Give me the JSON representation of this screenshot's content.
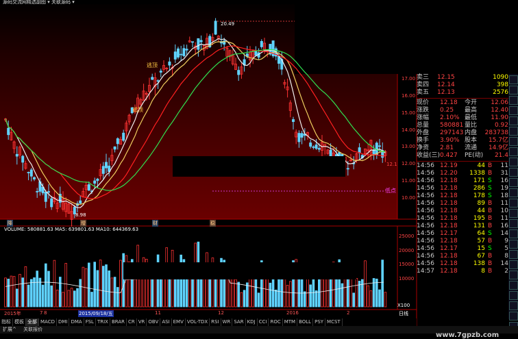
{
  "title_bar": {
    "text": "源码交流网精选副图 ▾ 关联源码 ▾"
  },
  "chart": {
    "price_labels": [
      "17.00",
      "16.00",
      "15.00",
      "14.00",
      "13.00",
      "12.00",
      "11.00",
      "10.00"
    ],
    "volume_labels": [
      "25000",
      "20000",
      "15000",
      "10000"
    ],
    "volume_multiplier": "X100",
    "high_label": "20.49",
    "low_label": "8.98",
    "current_price_tag": "12.1",
    "annotations": [
      "逃顶",
      "逃顶",
      "低点"
    ],
    "indicator_row": [
      "降",
      "增",
      "财",
      "稳"
    ],
    "volume_title": "VOLUME: 580881.63  MA5: 639801.63  MA10: 644369.63",
    "date_axis": [
      "2015年",
      "7",
      "8",
      "2015/09/18/五",
      "11",
      "12",
      "2016",
      "2"
    ],
    "zoom_label": "日线",
    "colors": {
      "up": "#ff3333",
      "down": "#5fd3ff",
      "ma5": "#f0f0f0",
      "ma10": "#f0d060",
      "ma20": "#ff2020",
      "ma30": "#30e050",
      "bg_top": "#000000",
      "bg_bottom": "#6a0000"
    }
  },
  "quote_panel": {
    "orders": [
      {
        "label": "卖三",
        "price": "12.15",
        "vol": "1090"
      },
      {
        "label": "卖四",
        "price": "12.14",
        "vol": "398"
      },
      {
        "label": "卖五",
        "price": "12.13",
        "vol": "2576"
      }
    ],
    "stats": [
      {
        "l1": "现价",
        "v1": "12.18",
        "l2": "今开",
        "v2": "12.06"
      },
      {
        "l1": "涨跌",
        "v1": "0.25",
        "l2": "最高",
        "v2": "12.40"
      },
      {
        "l1": "涨幅",
        "v1": "2.10%",
        "l2": "最低",
        "v2": "11.90"
      },
      {
        "l1": "总量",
        "v1": "580881",
        "l2": "量比",
        "v2": "0.92"
      },
      {
        "l1": "外盘",
        "v1": "297143",
        "l2": "内盘",
        "v2": "283738"
      },
      {
        "l1": "换手",
        "v1": "3.90%",
        "l2": "股本",
        "v2": "15.7亿"
      },
      {
        "l1": "净资",
        "v1": "2.81",
        "l2": "流通",
        "v2": "14.9亿"
      },
      {
        "l1": "收益(三)",
        "v1": "0.427",
        "l2": "PE(动)",
        "v2": "21.4"
      }
    ],
    "ticks": [
      {
        "t": "14:56",
        "p": "12.19",
        "v": "44",
        "s": "B",
        "n": "11"
      },
      {
        "t": "14:56",
        "p": "12.20",
        "v": "1338",
        "s": "B",
        "n": "31"
      },
      {
        "t": "14:56",
        "p": "12.18",
        "v": "171",
        "s": "S",
        "n": "16"
      },
      {
        "t": "14:56",
        "p": "12.18",
        "v": "286",
        "s": "S",
        "n": "19"
      },
      {
        "t": "14:56",
        "p": "12.18",
        "v": "178",
        "s": "S",
        "n": "18"
      },
      {
        "t": "14:56",
        "p": "12.18",
        "v": "89",
        "s": "B",
        "n": "11"
      },
      {
        "t": "14:56",
        "p": "12.18",
        "v": "44",
        "s": "B",
        "n": "10"
      },
      {
        "t": "14:56",
        "p": "12.18",
        "v": "195",
        "s": "B",
        "n": "11"
      },
      {
        "t": "14:56",
        "p": "12.18",
        "v": "131",
        "s": "B",
        "n": "16"
      },
      {
        "t": "14:56",
        "p": "12.17",
        "v": "64",
        "s": "S",
        "n": "14"
      },
      {
        "t": "14:56",
        "p": "12.18",
        "v": "57",
        "s": "B",
        "n": "9"
      },
      {
        "t": "14:56",
        "p": "12.17",
        "v": "15",
        "s": "S",
        "n": "5"
      },
      {
        "t": "14:56",
        "p": "12.18",
        "v": "67",
        "s": "B",
        "n": "8"
      },
      {
        "t": "14:56",
        "p": "12.18",
        "v": "138",
        "s": "B",
        "n": "14"
      },
      {
        "t": "14:57",
        "p": "12.18",
        "v": "8",
        "s": "B",
        "n": "2"
      }
    ]
  },
  "tabs": [
    "指标",
    "模板",
    "全部",
    "MACD",
    "DMI",
    "DMA",
    "FSL",
    "TRIX",
    "BRAR",
    "CR",
    "VR",
    "OBV",
    "ASI",
    "EMV",
    "VOL-TDX",
    "RSI",
    "WR",
    "SAR",
    "KDJ",
    "CCI",
    "ROC",
    "MTM",
    "BOLL",
    "PSY",
    "MCST"
  ],
  "active_tab": "全部",
  "bottom_bar": {
    "left": "扩展^",
    "right": "关联报价"
  },
  "watermark": "www.7gpzb.com",
  "right_toolbar": [
    "icon-1",
    "icon-2",
    "icon-3",
    "icon-4",
    "icon-5",
    "icon-6",
    "icon-7",
    "icon-8",
    "icon-9",
    "icon-10",
    "icon-11",
    "icon-12",
    "icon-13",
    "icon-14",
    "icon-15",
    "icon-16",
    "icon-17",
    "icon-18",
    "icon-19",
    "icon-20",
    "icon-21",
    "icon-22",
    "icon-23",
    "icon-24",
    "icon-25"
  ]
}
